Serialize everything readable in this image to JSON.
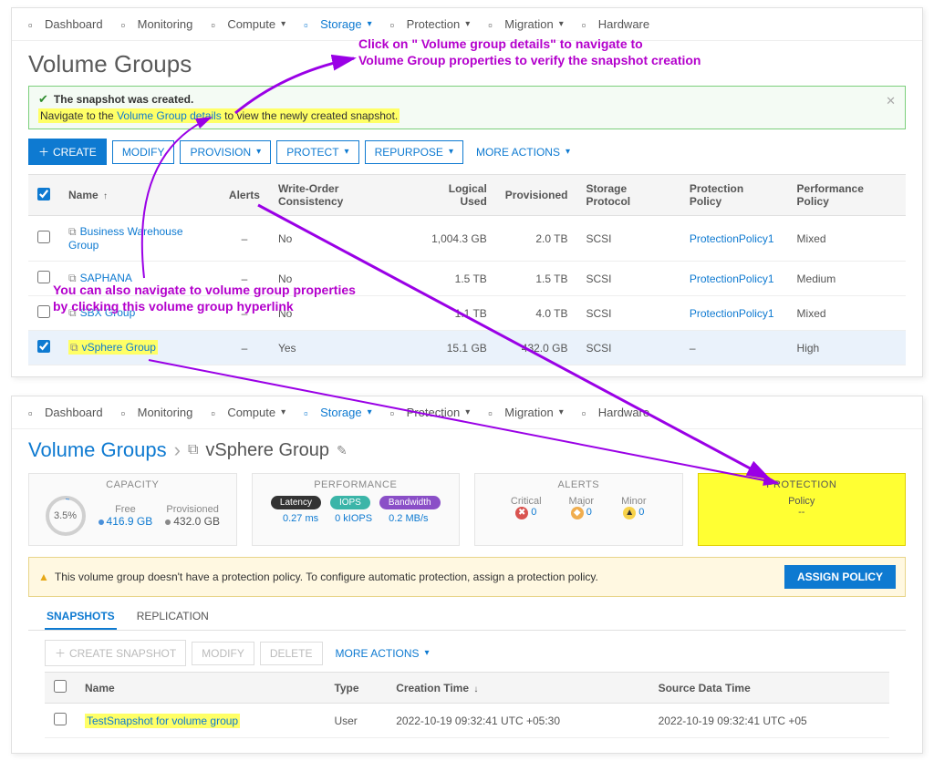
{
  "nav": [
    {
      "label": "Dashboard",
      "caret": false
    },
    {
      "label": "Monitoring",
      "caret": false
    },
    {
      "label": "Compute",
      "caret": true
    },
    {
      "label": "Storage",
      "caret": true,
      "active": true
    },
    {
      "label": "Protection",
      "caret": true
    },
    {
      "label": "Migration",
      "caret": true
    },
    {
      "label": "Hardware",
      "caret": false
    }
  ],
  "page1": {
    "title": "Volume Groups",
    "banner": {
      "line1": "The snapshot was created.",
      "line2_pre": "Navigate to the ",
      "line2_link": "Volume Group details",
      "line2_post": " to view the newly created snapshot."
    },
    "buttons": {
      "create": "CREATE",
      "modify": "MODIFY",
      "provision": "PROVISION",
      "protect": "PROTECT",
      "repurpose": "REPURPOSE",
      "more": "MORE ACTIONS"
    },
    "headers": {
      "name": "Name",
      "alerts": "Alerts",
      "woc": "Write-Order Consistency",
      "logical": "Logical Used",
      "provisioned": "Provisioned",
      "protocol": "Storage Protocol",
      "policy": "Protection Policy",
      "perf": "Performance Policy"
    },
    "rows": [
      {
        "name": "Business Warehouse Group",
        "alerts": "–",
        "woc": "No",
        "logical": "1,004.3 GB",
        "prov": "2.0 TB",
        "proto": "SCSI",
        "policy": "ProtectionPolicy1",
        "perf": "Mixed",
        "checked": false
      },
      {
        "name": "SAPHANA",
        "alerts": "–",
        "woc": "No",
        "logical": "1.5 TB",
        "prov": "1.5 TB",
        "proto": "SCSI",
        "policy": "ProtectionPolicy1",
        "perf": "Medium",
        "checked": false
      },
      {
        "name": "SBX Group",
        "alerts": "–",
        "woc": "No",
        "logical": "1.1 TB",
        "prov": "4.0 TB",
        "proto": "SCSI",
        "policy": "ProtectionPolicy1",
        "perf": "Mixed",
        "checked": false
      },
      {
        "name": "vSphere Group",
        "alerts": "–",
        "woc": "Yes",
        "logical": "15.1 GB",
        "prov": "432.0 GB",
        "proto": "SCSI",
        "policy": "–",
        "perf": "High",
        "checked": true,
        "highlight": true
      }
    ]
  },
  "annotations": {
    "a1": "Click on \" Volume group details\" to navigate to\nVolume Group properties to verify the snapshot creation",
    "a2": "You can also navigate to volume group properties\nby clicking this volume group hyperlink"
  },
  "page2": {
    "crumb_root": "Volume Groups",
    "crumb_sub": "vSphere Group",
    "capacity": {
      "title": "CAPACITY",
      "pct": "3.5%",
      "free_label": "Free",
      "free": "416.9 GB",
      "prov_label": "Provisioned",
      "prov": "432.0 GB"
    },
    "performance": {
      "title": "PERFORMANCE",
      "latency_label": "Latency",
      "latency": "0.27 ms",
      "iops_label": "IOPS",
      "iops": "0 kIOPS",
      "bw_label": "Bandwidth",
      "bw": "0.2 MB/s"
    },
    "alerts_card": {
      "title": "ALERTS",
      "critical_label": "Critical",
      "critical": "0",
      "major_label": "Major",
      "major": "0",
      "minor_label": "Minor",
      "minor": "0"
    },
    "protection": {
      "title": "PROTECTION",
      "policy_label": "Policy",
      "policy": "--"
    },
    "warn": "This volume group doesn't have a protection policy. To configure automatic protection, assign a protection policy.",
    "assign": "ASSIGN POLICY",
    "tabs": {
      "snapshots": "SNAPSHOTS",
      "replication": "REPLICATION"
    },
    "snap_buttons": {
      "create": "CREATE SNAPSHOT",
      "modify": "MODIFY",
      "delete": "DELETE",
      "more": "MORE ACTIONS"
    },
    "snap_headers": {
      "name": "Name",
      "type": "Type",
      "ctime": "Creation Time",
      "stime": "Source Data Time"
    },
    "snap_rows": [
      {
        "name": "TestSnapshot for volume group",
        "type": "User",
        "ctime": "2022-10-19 09:32:41 UTC +05:30",
        "stime": "2022-10-19 09:32:41 UTC +05",
        "highlight": true
      }
    ]
  }
}
